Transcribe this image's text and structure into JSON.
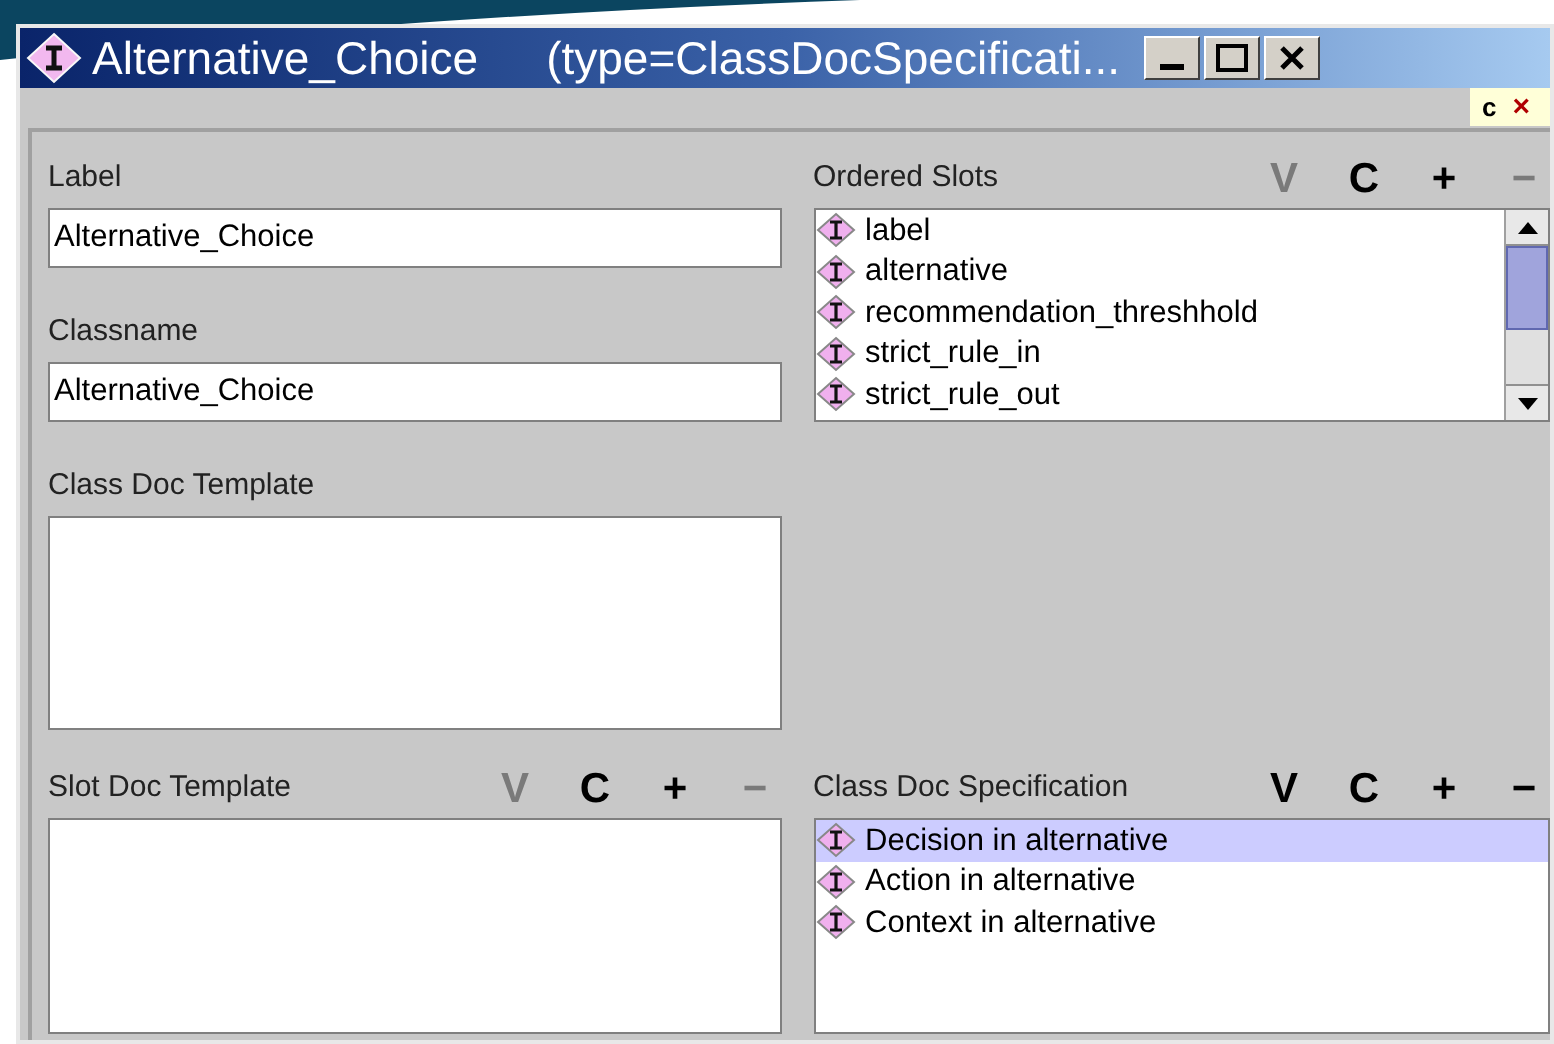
{
  "window": {
    "title": "Alternative_Choice",
    "type_text": "(type=ClassDocSpecificati..."
  },
  "corner_tab": {
    "label": "c",
    "close": "×"
  },
  "left": [
    {
      "kind": "field",
      "label": "Label",
      "value": "Alternative_Choice"
    },
    {
      "kind": "field",
      "label": "Classname",
      "value": "Alternative_Choice"
    },
    {
      "kind": "textarea",
      "label": "Class Doc Template"
    }
  ],
  "ordered_slots": {
    "label": "Ordered Slots",
    "actions": [
      {
        "label": "V",
        "disabled": true
      },
      {
        "label": "C",
        "disabled": false
      },
      {
        "label": "+",
        "disabled": false
      },
      {
        "label": "−",
        "disabled": true
      }
    ],
    "items": [
      {
        "text": "label",
        "selected": false
      },
      {
        "text": "alternative",
        "selected": false
      },
      {
        "text": "recommendation_threshhold",
        "selected": false
      },
      {
        "text": "strict_rule_in",
        "selected": false
      },
      {
        "text": "strict_rule_out",
        "selected": false
      }
    ]
  },
  "slot_doc_template": {
    "label": "Slot Doc Template",
    "actions": [
      {
        "label": "V",
        "disabled": true
      },
      {
        "label": "C",
        "disabled": false
      },
      {
        "label": "+",
        "disabled": false
      },
      {
        "label": "−",
        "disabled": true
      }
    ]
  },
  "class_doc_specification": {
    "label": "Class Doc Specification",
    "actions": [
      {
        "label": "V",
        "disabled": false
      },
      {
        "label": "C",
        "disabled": false
      },
      {
        "label": "+",
        "disabled": false
      },
      {
        "label": "−",
        "disabled": false
      }
    ],
    "items": [
      {
        "text": "Decision in alternative",
        "selected": true
      },
      {
        "text": "Action in alternative",
        "selected": false
      },
      {
        "text": "Context in alternative",
        "selected": false
      }
    ]
  }
}
